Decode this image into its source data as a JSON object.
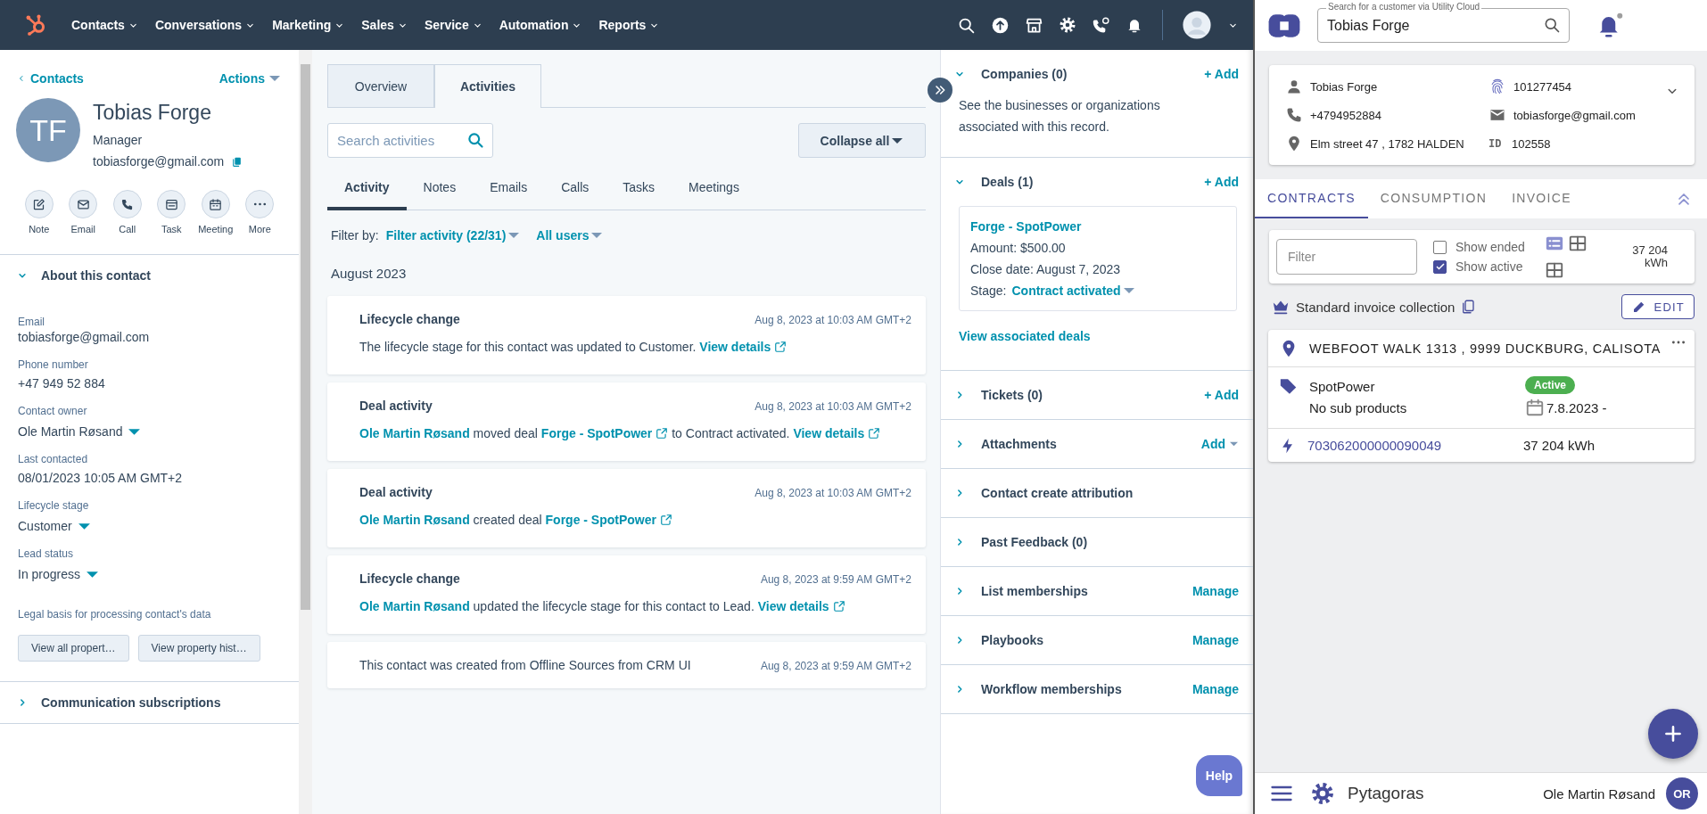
{
  "top_nav": {
    "menu": [
      {
        "label": "Contacts"
      },
      {
        "label": "Conversations"
      },
      {
        "label": "Marketing"
      },
      {
        "label": "Sales"
      },
      {
        "label": "Service"
      },
      {
        "label": "Automation"
      },
      {
        "label": "Reports"
      }
    ]
  },
  "contact": {
    "back_link": "Contacts",
    "actions": "Actions",
    "initials": "TF",
    "name": "Tobias Forge",
    "job_title": "Manager",
    "email": "tobiasforge@gmail.com",
    "quick_actions": [
      {
        "kind": "note",
        "label": "Note"
      },
      {
        "kind": "email",
        "label": "Email"
      },
      {
        "kind": "call",
        "label": "Call"
      },
      {
        "kind": "task",
        "label": "Task"
      },
      {
        "kind": "meeting",
        "label": "Meeting"
      },
      {
        "kind": "more",
        "label": "More"
      }
    ]
  },
  "about": {
    "title": "About this contact",
    "expanded": true,
    "properties": [
      {
        "label": "Email",
        "value": "tobiasforge@gmail.com",
        "kind": "text"
      },
      {
        "label": "Phone number",
        "value": "+47 949 52 884",
        "kind": "text"
      },
      {
        "label": "Contact owner",
        "value": "Ole Martin Røsand",
        "kind": "dropdown"
      },
      {
        "label": "Last contacted",
        "value": "08/01/2023 10:05 AM GMT+2",
        "kind": "text"
      },
      {
        "label": "Lifecycle stage",
        "value": "Customer",
        "kind": "dropdown"
      },
      {
        "label": "Lead status",
        "value": "In progress",
        "kind": "dropdown"
      }
    ],
    "legal_basis": "Legal basis for processing contact's data",
    "buttons": [
      "View all propert…",
      "View property hist…"
    ]
  },
  "left_sections": [
    {
      "title": "Communication subscriptions",
      "expanded": false
    }
  ],
  "middle": {
    "tabs": [
      {
        "label": "Overview",
        "selected": false
      },
      {
        "label": "Activities",
        "selected": true
      }
    ],
    "search": {
      "placeholder": "Search activities"
    },
    "collapse_button": "Collapse all",
    "subtabs": [
      {
        "label": "Activity",
        "selected": true
      },
      {
        "label": "Notes",
        "selected": false
      },
      {
        "label": "Emails",
        "selected": false
      },
      {
        "label": "Calls",
        "selected": false
      },
      {
        "label": "Tasks",
        "selected": false
      },
      {
        "label": "Meetings",
        "selected": false
      }
    ],
    "filter": {
      "label": "Filter by:",
      "activity": "Filter activity (22/31)",
      "users": "All users"
    },
    "month": "August 2023",
    "activities": [
      {
        "title": "Lifecycle change",
        "time": "Aug 8, 2023 at 10:03 AM GMT+2",
        "body": [
          {
            "kind": "text",
            "text": "The lifecycle stage for this contact was updated to Customer. "
          },
          {
            "kind": "external-link",
            "text": "View details"
          }
        ]
      },
      {
        "title": "Deal activity",
        "time": "Aug 8, 2023 at 10:03 AM GMT+2",
        "body": [
          {
            "kind": "link",
            "text": "Ole Martin Røsand"
          },
          {
            "kind": "text",
            "text": " moved deal "
          },
          {
            "kind": "external-link",
            "text": "Forge - SpotPower"
          },
          {
            "kind": "text",
            "text": " to Contract activated. "
          },
          {
            "kind": "external-link",
            "text": "View details"
          }
        ]
      },
      {
        "title": "Deal activity",
        "time": "Aug 8, 2023 at 10:03 AM GMT+2",
        "body": [
          {
            "kind": "link",
            "text": "Ole Martin Røsand"
          },
          {
            "kind": "text",
            "text": " created deal "
          },
          {
            "kind": "external-link",
            "text": "Forge - SpotPower"
          }
        ]
      },
      {
        "title": "Lifecycle change",
        "time": "Aug 8, 2023 at 9:59 AM GMT+2",
        "body": [
          {
            "kind": "link",
            "text": "Ole Martin Røsand"
          },
          {
            "kind": "text",
            "text": " updated the lifecycle stage for this contact to Lead. "
          },
          {
            "kind": "external-link",
            "text": "View details"
          }
        ]
      },
      {
        "time": "Aug 8, 2023 at 9:59 AM GMT+2",
        "body": [
          {
            "kind": "text",
            "text": "This contact was created from Offline Sources from CRM UI"
          }
        ]
      }
    ]
  },
  "right_sidebar": {
    "sections": [
      {
        "title": "Companies (0)",
        "expanded": true,
        "action": "+ Add",
        "description": "See the businesses or organizations associated with this record."
      },
      {
        "title": "Deals (1)",
        "expanded": true,
        "action": "+ Add",
        "deal": {
          "name": "Forge - SpotPower",
          "amount": "Amount: $500.00",
          "close_date": "Close date: August 7, 2023",
          "stage_label": "Stage:",
          "stage": "Contract activated"
        },
        "footer_link": "View associated deals"
      },
      {
        "title": "Tickets (0)",
        "expanded": false,
        "action": "+ Add"
      },
      {
        "title": "Attachments",
        "expanded": false,
        "action": "Add",
        "action_menu": true
      },
      {
        "title": "Contact create attribution",
        "expanded": false
      },
      {
        "title": "Past Feedback (0)",
        "expanded": false
      },
      {
        "title": "List memberships",
        "expanded": false,
        "action": "Manage"
      },
      {
        "title": "Playbooks",
        "expanded": false,
        "action": "Manage"
      },
      {
        "title": "Workflow memberships",
        "expanded": false,
        "action": "Manage"
      }
    ],
    "help_button": "Help"
  },
  "utility_panel": {
    "search": {
      "label": "Search for a customer via Utility Cloud",
      "value": "Tobias Forge"
    },
    "customer": [
      {
        "kind": "person",
        "text": "Tobias Forge"
      },
      {
        "kind": "fingerprint",
        "text": "101277454"
      },
      {
        "kind": "phone",
        "text": "+4794952884"
      },
      {
        "kind": "email",
        "text": "tobiasforge@gmail.com"
      },
      {
        "kind": "location",
        "text": "Elm street 47 , 1782 HALDEN"
      },
      {
        "kind": "id",
        "label": "ID",
        "text": "102558"
      }
    ],
    "tabs": [
      {
        "label": "CONTRACTS",
        "selected": true
      },
      {
        "label": "CONSUMPTION",
        "selected": false
      },
      {
        "label": "INVOICE",
        "selected": false
      }
    ],
    "filter": {
      "placeholder": "Filter"
    },
    "checkboxes": [
      {
        "label": "Show ended",
        "checked": false
      },
      {
        "label": "Show active",
        "checked": true
      }
    ],
    "view_modes": [
      {
        "kind": "list",
        "selected": true
      },
      {
        "kind": "grid",
        "selected": false
      },
      {
        "kind": "grid",
        "selected": false
      }
    ],
    "total": "37 204 kWh",
    "invoice_collection": "Standard invoice collection",
    "edit_button": "EDIT",
    "contracts": [
      {
        "address": "WEBFOOT WALK 1313 , 9999 DUCKBURG, CALISOTA",
        "product": "SpotPower",
        "sub_products": "No sub products",
        "status": "Active",
        "start_date": "7.8.2023 -",
        "meter_id": "703062000000090049",
        "consumption": "37 204 kWh"
      }
    ],
    "footer": {
      "app_name": "Pytagoras",
      "user_name": "Ole Martin Røsand",
      "user_initials": "OR"
    }
  }
}
